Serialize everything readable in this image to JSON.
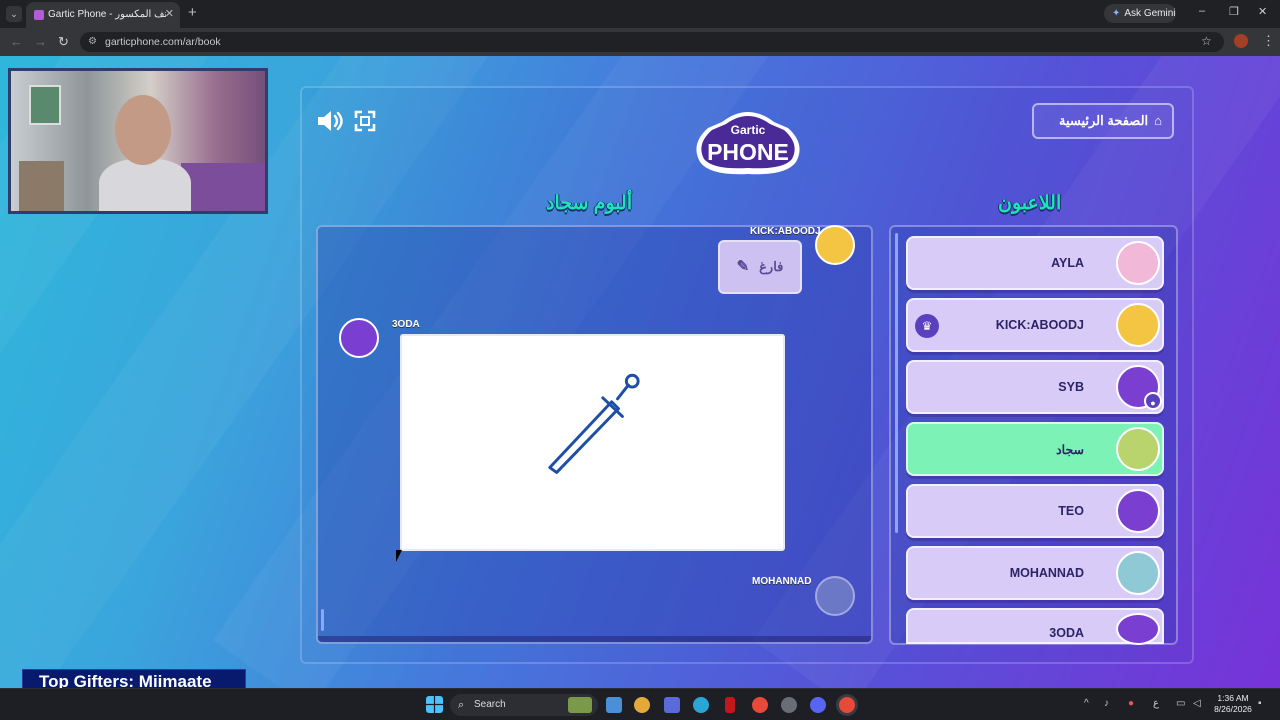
{
  "browser": {
    "tab_title": "Gartic Phone - الهاتف المكسور",
    "new_tab": "+",
    "gemini": "Ask Gemini",
    "url": "garticphone.com/ar/book",
    "window_controls": [
      "–",
      "❐",
      "✕"
    ]
  },
  "game": {
    "logo_top": "Gartic",
    "logo_bottom": "PHONE",
    "home_button": "الصفحة الرئيسية",
    "album_title": "ألبوم سجاد",
    "players_title": "اللاعبون",
    "album": {
      "entry1_author": "KICK:ABOODJ",
      "entry1_text": "فارغ",
      "entry2_author": "3ODA",
      "entry3_author": "MOHANNAD"
    },
    "players": [
      {
        "name": "AYLA",
        "avatar_color": "#f2b8d8"
      },
      {
        "name": "KICK:ABOODJ",
        "avatar_color": "#f4c542",
        "host": true
      },
      {
        "name": "SYB",
        "avatar_color": "#7a3fd0"
      },
      {
        "name": "سجاد",
        "avatar_color": "#b9d46c",
        "active": true
      },
      {
        "name": "TEO",
        "avatar_color": "#7a3fd0"
      },
      {
        "name": "MOHANNAD",
        "avatar_color": "#8fc9d6"
      },
      {
        "name": "3ODA",
        "avatar_color": "#7a3fd0"
      }
    ]
  },
  "overlay": {
    "top_gifters": "Top Gifters: Miimaate"
  },
  "taskbar": {
    "search": "Search",
    "lang": "ع",
    "time": "1:36 AM",
    "date": "8/26/2026"
  },
  "colors": {
    "accent_green": "#1ee5b8",
    "active_card": "#7cf2b6",
    "card": "#d8cbf7"
  }
}
